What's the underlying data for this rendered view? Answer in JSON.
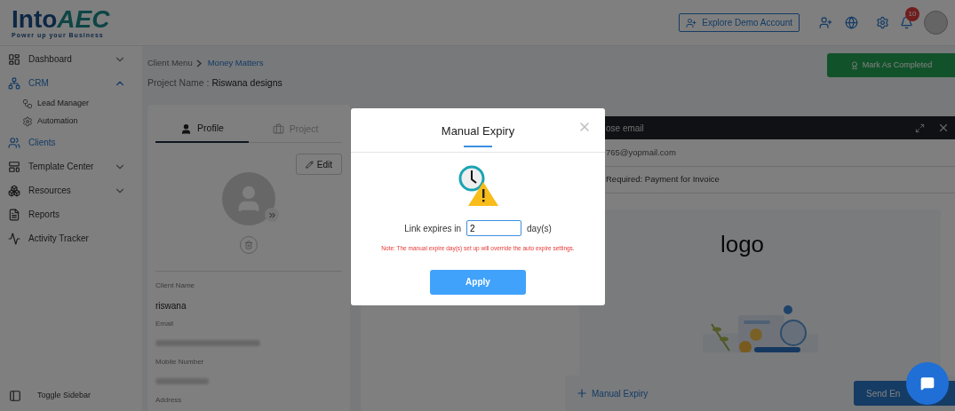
{
  "logo": {
    "text": "Into",
    "accent": "AEC",
    "tagline": "Power up your Business"
  },
  "header": {
    "demo_button": "Explore Demo Account",
    "notification_count": "10"
  },
  "sidebar": {
    "items": [
      {
        "label": "Dashboard",
        "kind": "group",
        "selected": false,
        "expanded": false
      },
      {
        "label": "CRM",
        "kind": "group",
        "selected": true,
        "expanded": true,
        "children": [
          {
            "label": "Lead Manager"
          },
          {
            "label": "Automation"
          }
        ]
      },
      {
        "label": "Clients",
        "kind": "link",
        "selected": true
      },
      {
        "label": "Template Center",
        "kind": "group",
        "selected": false,
        "expanded": false
      },
      {
        "label": "Resources",
        "kind": "group",
        "selected": false,
        "expanded": false
      },
      {
        "label": "Reports",
        "kind": "link",
        "selected": false
      },
      {
        "label": "Activity Tracker",
        "kind": "link",
        "selected": false
      }
    ],
    "toggle": "Toggle Sidebar"
  },
  "breadcrumb": [
    "Client Menu",
    "Money Matters"
  ],
  "project": {
    "label": "Project Name :",
    "name": "Riswana designs"
  },
  "mark_completed": "Mark As Completed",
  "profile_card": {
    "tabs": [
      {
        "label": "Profile",
        "selected": true
      },
      {
        "label": "Project",
        "selected": false
      }
    ],
    "edit": "Edit",
    "fields": [
      {
        "label": "Client Name",
        "kind": "text",
        "value": "riswana"
      },
      {
        "label": "Email",
        "kind": "blurred"
      },
      {
        "label": "Mobile Number",
        "kind": "blurred"
      },
      {
        "label": "Address",
        "kind": "empty"
      }
    ]
  },
  "compose": {
    "title": "ose email",
    "to": "765@yopmail.com",
    "subject": "Required: Payment for Invoice",
    "logo_alt": "logo",
    "manual_expiry": "Manual Expiry",
    "send": "Send En"
  },
  "modal": {
    "title": "Manual Expiry",
    "label": "Link expires in",
    "value": "2",
    "unit": "day(s)",
    "note": "Note: The manual expire day(s) set up will override the auto expire settings.",
    "apply": "Apply"
  }
}
